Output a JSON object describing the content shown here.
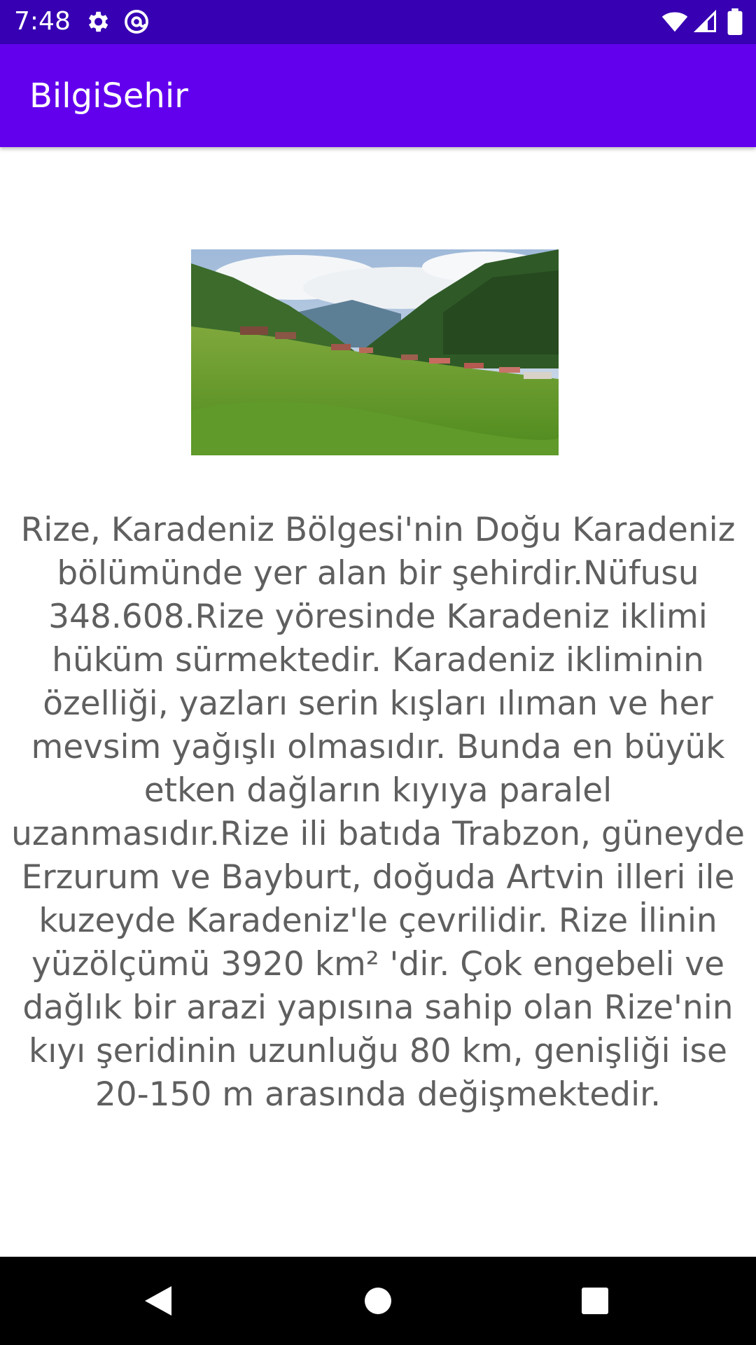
{
  "status_bar": {
    "time": "7:48",
    "icons": [
      "gear-icon",
      "at-sign-icon",
      "wifi-icon",
      "signal-icon",
      "battery-icon"
    ],
    "background": "#3700b3"
  },
  "app_bar": {
    "title": "BilgiSehir",
    "background": "#6200ee"
  },
  "content": {
    "image": "rize-landscape-photo",
    "description": "Rize, Karadeniz Bölgesi'nin Doğu Karadeniz bölümünde yer alan bir şehirdir.Nüfusu 348.608.Rize yöresinde Karadeniz iklimi hüküm sürmektedir. Karadeniz ikliminin özelliği, yazları serin kışları ılıman ve her mevsim yağışlı olmasıdır. Bunda en büyük etken dağların kıyıya paralel uzanmasıdır.Rize ili batıda Trabzon, güneyde Erzurum ve Bayburt, doğuda Artvin illeri ile kuzeyde Karadeniz'le çevrilidir. Rize İlinin yüzölçümü 3920 km² 'dir. Çok engebeli ve dağlık bir arazi yapısına sahip olan Rize'nin kıyı şeridinin uzunluğu 80 km, genişliği ise 20-150 m arasında değişmektedir."
  },
  "nav_bar": {
    "buttons": [
      "back-icon",
      "home-icon",
      "recents-icon"
    ]
  }
}
